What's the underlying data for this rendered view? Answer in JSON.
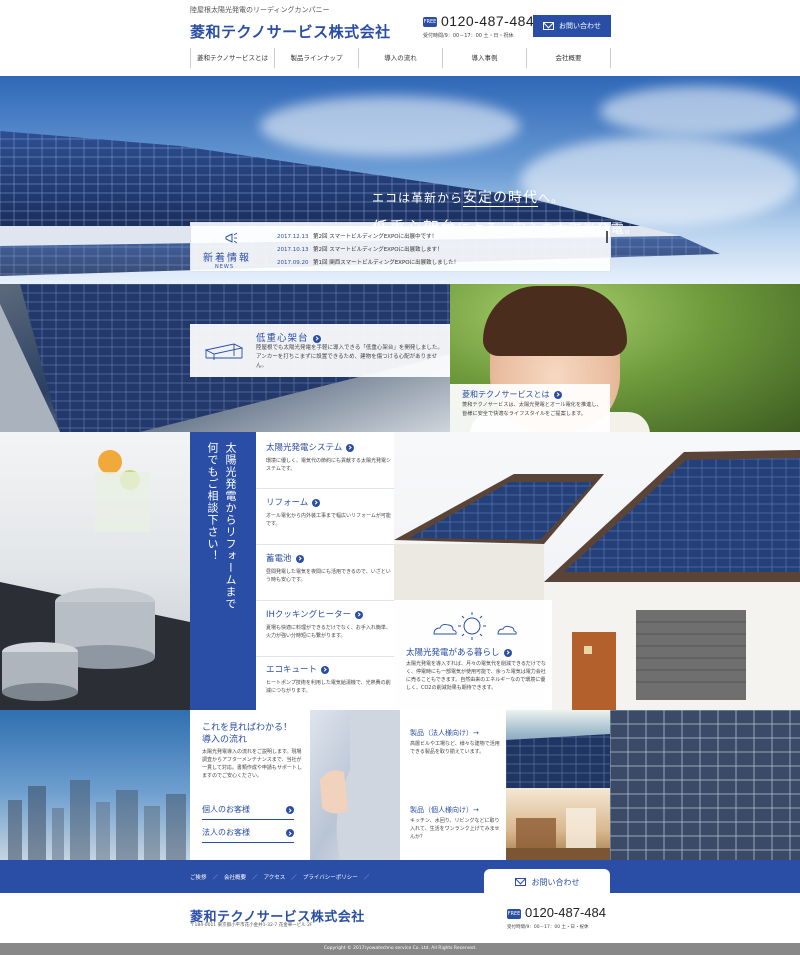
{
  "header": {
    "tagline": "陸屋根太陽光発電のリーディングカンパニー",
    "logo": "菱和テクノサービス株式会社",
    "free_badge": "FREE",
    "phone": "0120-487-484",
    "hours": "受付時間/9：00－17：00 土・日・祝休",
    "contact_label": "お問い合わせ"
  },
  "nav": [
    "菱和テクノサービスとは",
    "製品ラインナップ",
    "導入の流れ",
    "導入事例",
    "会社概要"
  ],
  "hero": {
    "line1_pre": "エコは革新から",
    "line1_hl": "安定の時代",
    "line1_post": "へ。",
    "line2_big": "低重心架台",
    "line2_rest": "による、安心の太陽光発電。"
  },
  "news": {
    "title": "新着情報",
    "title_en": "NEWS",
    "items": [
      {
        "date": "2017.12.13",
        "title": "第2回 スマートビルディングEXPOに出展中です！"
      },
      {
        "date": "2017.10.13",
        "title": "第2回 スマートビルディングEXPOに出展致します！"
      },
      {
        "date": "2017.09.20",
        "title": "第1回 関西スマートビルディングEXPOに出展致しました！"
      }
    ]
  },
  "low_cg": {
    "title": "低重心架台",
    "body": "陸屋根でも太陽光発電を手軽に導入できる「低重心架台」を開発しました。アンカーを打ちこまずに設置できるため、建物を傷つける心配がありません。"
  },
  "about": {
    "title": "菱和テクノサービスとは",
    "body": "菱和テクノサービスは、太陽光発電とオール電化を推進し、皆様に安全で快適なライフスタイルをご提案します。"
  },
  "consult": {
    "col1": "太陽光発電からリフォームまで",
    "col2": "何でもご相談下さい！"
  },
  "services": [
    {
      "title": "太陽光発電システム",
      "desc": "環境に優しく、電気代の節約にも貢献する太陽光発電システムです。"
    },
    {
      "title": "リフォーム",
      "desc": "オール電化から内外装工事まで幅広いリフォームが可能です。"
    },
    {
      "title": "蓄電池",
      "desc": "昼間発電した電気を夜間にも活用できるので、いざという時も安心です。"
    },
    {
      "title": "IHクッキングヒーター",
      "desc": "夏場も快適に料理ができるだけでなく、お手入れ簡単、火力が強い分時短にも繋がります。"
    },
    {
      "title": "エコキュート",
      "desc": "ヒートポンプ技術を利用した電気給湯機で、光熱費の削減につながります。"
    }
  ],
  "life": {
    "title": "太陽光発電がある暮らし",
    "body": "太陽光発電を導入すれば、月々の電気代を削減できるだけでなく、停電時にも一部電気が使用可能で、余った電気は電力会社に売ることもできます。自然由来のエネルギーなので環境に優しく、CO2の削減効果も期待できます。"
  },
  "flow": {
    "title_line1": "これを見ればわかる！",
    "title_line2": "導入の流れ",
    "body": "太陽光発電導入の流れをご説明します。現場調査からアフターメンテナンスまで、当社が一貫して対応。書類作成や申請もサポートしますのでご安心ください。",
    "link_corporate": "個人のお客様",
    "link_personal": "法人のお客様"
  },
  "products": [
    {
      "title": "製品（法人様向け）→",
      "desc": "高層ビルや工場など、様々な建物で活用できる製品を取り揃えています。"
    },
    {
      "title": "製品（個人様向け）→",
      "desc": "キッチン、水回り、リビングなどに取り入れて、生活をワンランク上げてみませんか？"
    }
  ],
  "footer": {
    "links": [
      "ご挨拶",
      "会社概要",
      "アクセス",
      "プライバシーポリシー"
    ],
    "contact_label": "お問い合わせ",
    "logo": "菱和テクノサービス株式会社",
    "address": "〒184-0011 東京都小平市花小金井1-32-7 花金華ービル 2F",
    "free_badge": "FREE",
    "phone": "0120-487-484",
    "hours": "受付時間/9：00－17：00 土・日・祝休",
    "copyright": "Copyright © 2017ryowatechno service Co. Ltd. All Rights Reserved."
  },
  "colors": {
    "brand": "#2a4ea6"
  }
}
